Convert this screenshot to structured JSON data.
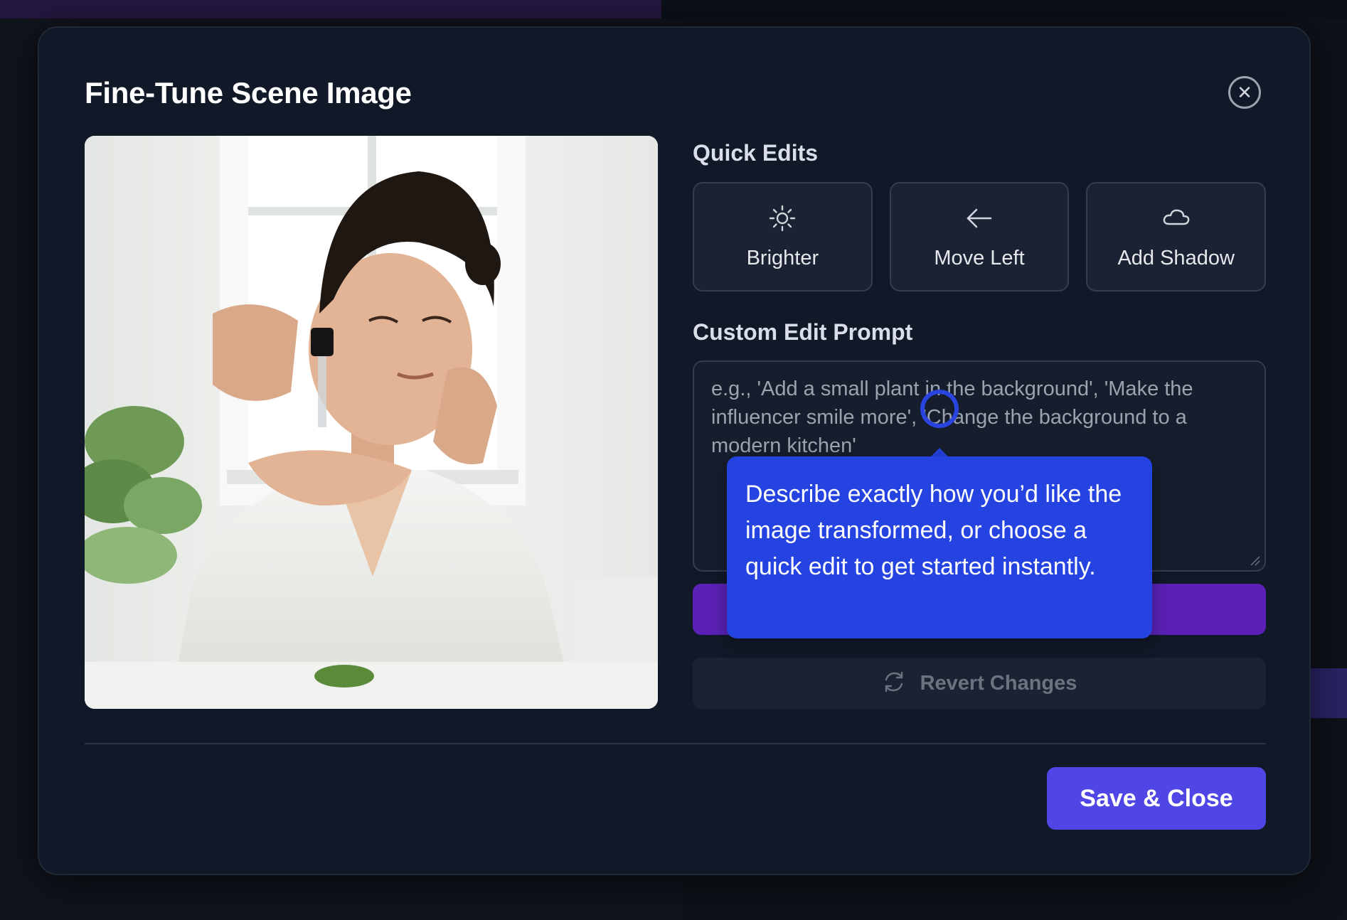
{
  "modal": {
    "title": "Fine-Tune Scene Image",
    "close_icon": "close-icon"
  },
  "quick_edits": {
    "label": "Quick Edits",
    "buttons": [
      {
        "label": "Brighter",
        "icon": "sun-icon"
      },
      {
        "label": "Move Left",
        "icon": "arrow-left-icon"
      },
      {
        "label": "Add Shadow",
        "icon": "cloud-icon"
      }
    ]
  },
  "custom_prompt": {
    "label": "Custom Edit Prompt",
    "placeholder": "e.g., 'Add a small plant in the background', 'Make the influencer smile more', 'Change the background to a modern kitchen'",
    "value": ""
  },
  "tooltip": {
    "text": "Describe exactly how you’d like the image transformed, or choose a quick edit to get started instantly."
  },
  "actions": {
    "revert_label": "Revert Changes",
    "revert_icon": "refresh-icon",
    "save_label": "Save & Close"
  },
  "colors": {
    "modal_bg": "#111827",
    "primary": "#4f46e5",
    "generate_purple": "#5b21b6",
    "tooltip_blue": "#2543e0"
  }
}
